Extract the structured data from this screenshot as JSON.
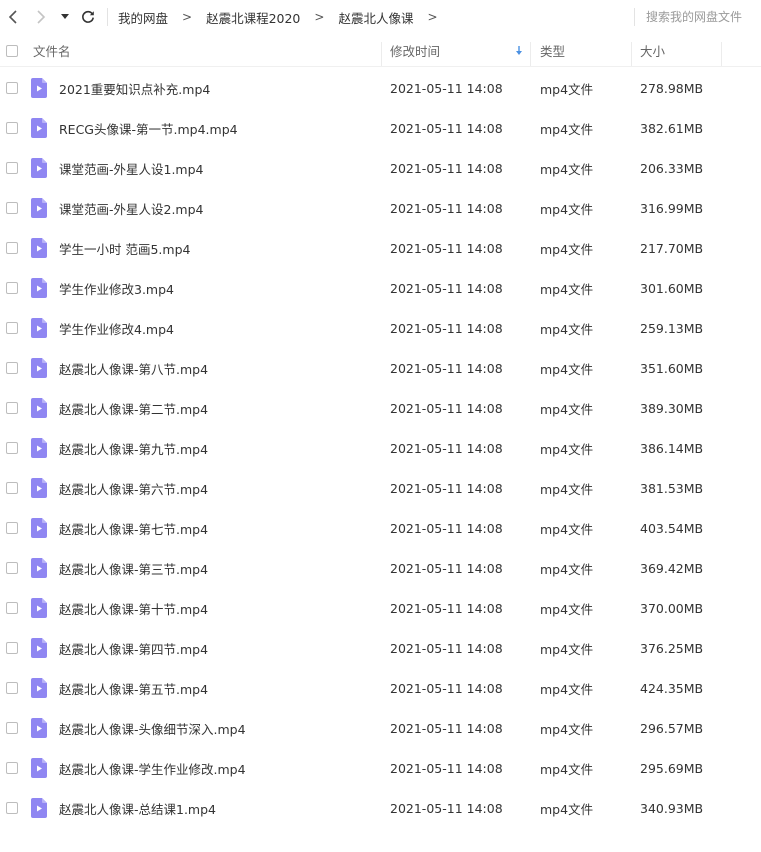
{
  "toolbar": {
    "back_icon": "chevron-left-icon",
    "forward_icon": "chevron-right-icon",
    "history_menu_icon": "caret-down-icon",
    "refresh_icon": "refresh-icon",
    "breadcrumbs": [
      "我的网盘",
      "赵震北课程2020",
      "赵震北人像课"
    ],
    "crumb_separator": ">",
    "search_placeholder": "搜索我的网盘文件"
  },
  "header": {
    "name": "文件名",
    "modified": "修改时间",
    "sort_icon": "arrow-down-icon",
    "type": "类型",
    "size": "大小"
  },
  "colors": {
    "file_icon": "#8f86f2",
    "sort_arrow": "#4a90e2"
  },
  "files": [
    {
      "name": "2021重要知识点补充.mp4",
      "modified": "2021-05-11 14:08",
      "type": "mp4文件",
      "size": "278.98MB"
    },
    {
      "name": "RECG头像课-第一节.mp4.mp4",
      "modified": "2021-05-11 14:08",
      "type": "mp4文件",
      "size": "382.61MB"
    },
    {
      "name": "课堂范画-外星人设1.mp4",
      "modified": "2021-05-11 14:08",
      "type": "mp4文件",
      "size": "206.33MB"
    },
    {
      "name": "课堂范画-外星人设2.mp4",
      "modified": "2021-05-11 14:08",
      "type": "mp4文件",
      "size": "316.99MB"
    },
    {
      "name": "学生一小时 范画5.mp4",
      "modified": "2021-05-11 14:08",
      "type": "mp4文件",
      "size": "217.70MB"
    },
    {
      "name": "学生作业修改3.mp4",
      "modified": "2021-05-11 14:08",
      "type": "mp4文件",
      "size": "301.60MB"
    },
    {
      "name": "学生作业修改4.mp4",
      "modified": "2021-05-11 14:08",
      "type": "mp4文件",
      "size": "259.13MB"
    },
    {
      "name": "赵震北人像课-第八节.mp4",
      "modified": "2021-05-11 14:08",
      "type": "mp4文件",
      "size": "351.60MB"
    },
    {
      "name": "赵震北人像课-第二节.mp4",
      "modified": "2021-05-11 14:08",
      "type": "mp4文件",
      "size": "389.30MB"
    },
    {
      "name": "赵震北人像课-第九节.mp4",
      "modified": "2021-05-11 14:08",
      "type": "mp4文件",
      "size": "386.14MB"
    },
    {
      "name": "赵震北人像课-第六节.mp4",
      "modified": "2021-05-11 14:08",
      "type": "mp4文件",
      "size": "381.53MB"
    },
    {
      "name": "赵震北人像课-第七节.mp4",
      "modified": "2021-05-11 14:08",
      "type": "mp4文件",
      "size": "403.54MB"
    },
    {
      "name": "赵震北人像课-第三节.mp4",
      "modified": "2021-05-11 14:08",
      "type": "mp4文件",
      "size": "369.42MB"
    },
    {
      "name": "赵震北人像课-第十节.mp4",
      "modified": "2021-05-11 14:08",
      "type": "mp4文件",
      "size": "370.00MB"
    },
    {
      "name": "赵震北人像课-第四节.mp4",
      "modified": "2021-05-11 14:08",
      "type": "mp4文件",
      "size": "376.25MB"
    },
    {
      "name": "赵震北人像课-第五节.mp4",
      "modified": "2021-05-11 14:08",
      "type": "mp4文件",
      "size": "424.35MB"
    },
    {
      "name": "赵震北人像课-头像细节深入.mp4",
      "modified": "2021-05-11 14:08",
      "type": "mp4文件",
      "size": "296.57MB"
    },
    {
      "name": "赵震北人像课-学生作业修改.mp4",
      "modified": "2021-05-11 14:08",
      "type": "mp4文件",
      "size": "295.69MB"
    },
    {
      "name": "赵震北人像课-总结课1.mp4",
      "modified": "2021-05-11 14:08",
      "type": "mp4文件",
      "size": "340.93MB"
    }
  ]
}
